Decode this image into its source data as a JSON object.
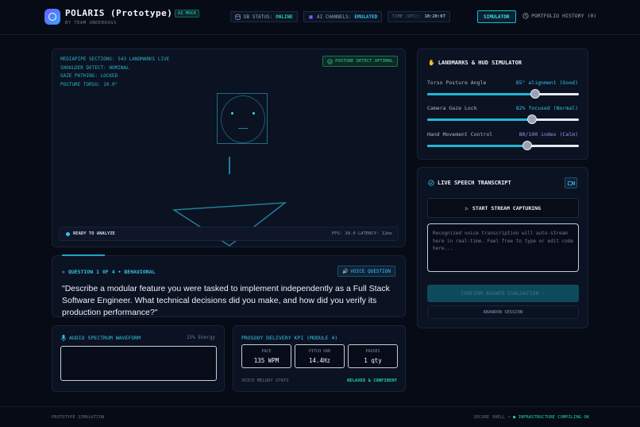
{
  "header": {
    "title": "POLARIS (Prototype)",
    "badge": "AI MOCK",
    "subtitle": "BY TEAM UNDERDOGS",
    "db_label": "DB STATUS:",
    "db_value": "ONLINE",
    "ai_label": "AI CHANNELS:",
    "ai_value": "EMULATED",
    "time_label": "TIME (UTC):",
    "time_value": "10:20:07",
    "simulator_label": "SIMULATOR",
    "history_label": "PORTFOLIO HISTORY (0)"
  },
  "camera": {
    "overlay": [
      "MEDIAPIPE SECTIONS: 543 LANDMARKS LIVE",
      "SHOULDER DETECT: NOMINAL",
      "GAZE PATHING: LOCKED",
      "POSTURE TORSO: 10.0°"
    ],
    "posture_button": "POSTURE DETECT OPTIMAL",
    "status": "READY TO ANALYZE",
    "fps": "FPS: 30.0   LATENCY: 12ms"
  },
  "question": {
    "header": "QUESTION 1 OF 4 • BEHAVIORAL",
    "voice_button": "VOICE QUESTION",
    "text": "\"Describe a modular feature you were tasked to implement independently as a Full Stack Software Engineer. What technical decisions did you make, and how did you verify its production performance?\""
  },
  "audio": {
    "title": "AUDIO SPECTRUM WAVEFORM",
    "energy": "15% Energy"
  },
  "prosody": {
    "title": "PROSODY DELIVERY KPI (MODULE 4)",
    "kpis": [
      {
        "label": "PACE",
        "value": "135 WPM"
      },
      {
        "label": "PITCH VAR",
        "value": "14.4Hz"
      },
      {
        "label": "PAUSES",
        "value": "1 qty"
      }
    ],
    "melody": "VOICE MELODY STATS",
    "status": "RELAXED & CONFIDENT"
  },
  "landmarks": {
    "title": "LANDMARKS & HUD SIMULATOR",
    "sliders": [
      {
        "label": "Torso Posture Angle",
        "value_text": "85° alignment (Good)",
        "level": 0.71,
        "color": "#2ec4e6"
      },
      {
        "label": "Camera Gaze Lock",
        "value_text": "82% focused (Normal)",
        "level": 0.69,
        "color": "#2ec4e6"
      },
      {
        "label": "Hand Movement Control",
        "value_text": "80/100 index (Calm)",
        "level": 0.66,
        "color": "#b08cf0"
      }
    ]
  },
  "speech": {
    "title": "LIVE SPEECH TRANSCRIPT",
    "stream_button": "START STREAM CAPTURING",
    "placeholder": "Recognized voice transcription will auto-stream here in real-time. Feel free to type or edit code here...",
    "confirm_button": "CONFIRM ANSWER EVALUATION",
    "abandon_button": "ABANDON SESSION"
  },
  "footer": {
    "left": "PROTOTYPE SIMULATION",
    "right_prefix": "SECURE SHELL •",
    "right_status": "● INFRASTRUCTURE COMPILING OK"
  }
}
